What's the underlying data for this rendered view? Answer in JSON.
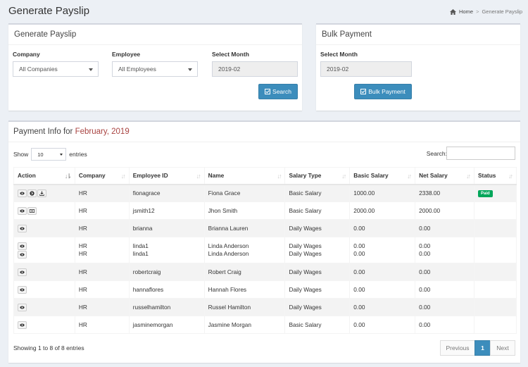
{
  "header": {
    "title": "Generate Payslip",
    "breadcrumb_home": "Home",
    "breadcrumb_sep": ">",
    "breadcrumb_current": "Generate Payslip"
  },
  "generate_box": {
    "title": "Generate Payslip",
    "company_label": "Company",
    "company_value": "All Companies",
    "employee_label": "Employee",
    "employee_value": "All Employees",
    "month_label": "Select Month",
    "month_value": "2019-02",
    "search_button": "Search"
  },
  "bulk_box": {
    "title": "Bulk Payment",
    "month_label": "Select Month",
    "month_value": "2019-02",
    "button": "Bulk Payment"
  },
  "payment": {
    "title_prefix": "Payment Info for",
    "title_month": "February,",
    "title_year": "2019",
    "show_label": "Show",
    "show_value": "10",
    "entries_label": "entries",
    "search_label": "Search:",
    "columns": [
      "Action",
      "Company",
      "Employee ID",
      "Name",
      "Salary Type",
      "Basic Salary",
      "Net Salary",
      "Status"
    ],
    "rows": [
      {
        "actions": [
          "eye",
          "arrow",
          "download"
        ],
        "company": "HR",
        "employee_id": [
          "fionagrace"
        ],
        "name": [
          "Fiona Grace"
        ],
        "salary_type": [
          "Basic Salary"
        ],
        "basic": [
          "1000.00"
        ],
        "net": [
          "2338.00"
        ],
        "status": "Paid"
      },
      {
        "actions": [
          "eye",
          "money"
        ],
        "company": "HR",
        "employee_id": [
          "jsmith12"
        ],
        "name": [
          "Jhon Smith"
        ],
        "salary_type": [
          "Basic Salary"
        ],
        "basic": [
          "2000.00"
        ],
        "net": [
          "2000.00"
        ],
        "status": ""
      },
      {
        "actions": [
          "eye"
        ],
        "company": "HR",
        "employee_id": [
          "brianna"
        ],
        "name": [
          "Brianna Lauren"
        ],
        "salary_type": [
          "Daily Wages"
        ],
        "basic": [
          "0.00"
        ],
        "net": [
          "0.00"
        ],
        "status": ""
      },
      {
        "actions": [
          "eye",
          "eye"
        ],
        "company": "HR",
        "company2": "HR",
        "employee_id": [
          "linda1",
          "linda1"
        ],
        "name": [
          "Linda Anderson",
          "Linda Anderson"
        ],
        "salary_type": [
          "Daily Wages",
          "Daily Wages"
        ],
        "basic": [
          "0.00",
          "0.00"
        ],
        "net": [
          "0.00",
          "0.00"
        ],
        "status": ""
      },
      {
        "actions": [
          "eye"
        ],
        "company": "HR",
        "employee_id": [
          "robertcraig"
        ],
        "name": [
          "Robert Craig"
        ],
        "salary_type": [
          "Daily Wages"
        ],
        "basic": [
          "0.00"
        ],
        "net": [
          "0.00"
        ],
        "status": ""
      },
      {
        "actions": [
          "eye"
        ],
        "company": "HR",
        "employee_id": [
          "hannaflores"
        ],
        "name": [
          "Hannah Flores"
        ],
        "salary_type": [
          "Daily Wages"
        ],
        "basic": [
          "0.00"
        ],
        "net": [
          "0.00"
        ],
        "status": ""
      },
      {
        "actions": [
          "eye"
        ],
        "company": "HR",
        "employee_id": [
          "russelhamilton"
        ],
        "name": [
          "Russel Hamilton"
        ],
        "salary_type": [
          "Daily Wages"
        ],
        "basic": [
          "0.00"
        ],
        "net": [
          "0.00"
        ],
        "status": ""
      },
      {
        "actions": [
          "eye"
        ],
        "company": "HR",
        "employee_id": [
          "jasminemorgan"
        ],
        "name": [
          "Jasmine Morgan"
        ],
        "salary_type": [
          "Basic Salary"
        ],
        "basic": [
          "0.00"
        ],
        "net": [
          "0.00"
        ],
        "status": ""
      }
    ],
    "showing_text": "Showing 1 to 8 of 8 entries",
    "pager": {
      "previous": "Previous",
      "page": "1",
      "next": "Next"
    }
  },
  "colors": {
    "primary": "#3c8dbc",
    "paid": "#00a65a",
    "title_highlight": "#a94442"
  }
}
